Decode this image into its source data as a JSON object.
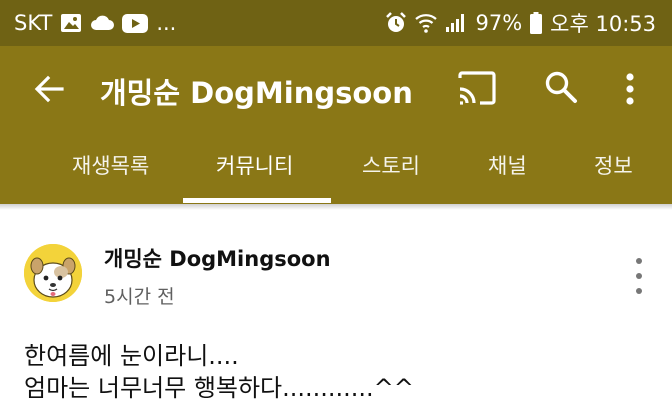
{
  "status_bar": {
    "carrier": "SKT",
    "ellipsis": "...",
    "battery": "97%",
    "time": "오후 10:53",
    "icons": [
      "image-icon",
      "cloud-icon",
      "youtube-icon",
      "alarm-icon",
      "wifi-icon",
      "signal-icon",
      "battery-icon"
    ]
  },
  "app_bar": {
    "title": "개밍순 DogMingsoon",
    "background": "#8a7716",
    "icons": [
      "back-arrow-icon",
      "cast-icon",
      "search-icon",
      "more-vert-icon"
    ]
  },
  "tabs": [
    {
      "label": "재생목록",
      "active": false
    },
    {
      "label": "커뮤니티",
      "active": true
    },
    {
      "label": "스토리",
      "active": false
    },
    {
      "label": "채널",
      "active": false
    },
    {
      "label": "정보",
      "active": false
    }
  ],
  "post": {
    "channel_name": "개밍순 DogMingsoon",
    "time": "5시간 전",
    "lines": [
      "한여름에 눈이라니....",
      "엄마는 너무너무 행복하다............^^"
    ]
  }
}
